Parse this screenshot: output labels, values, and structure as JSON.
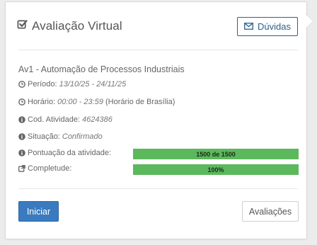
{
  "header": {
    "title": "Avaliação Virtual",
    "icon": "check-square-icon"
  },
  "help_button": {
    "label": "Dúvidas",
    "icon": "envelope-icon"
  },
  "activity": {
    "title": "Av1 - Automação de Processos Industriais",
    "periodo": {
      "label": "Período:",
      "value": "13/10/25 - 24/11/25",
      "icon": "clock-icon"
    },
    "horario": {
      "label": "Horário:",
      "value": "00:00 - 23:59",
      "extra": "(Horário de Brasília)",
      "icon": "clock-icon"
    },
    "codigo": {
      "label": "Cod. Atividade:",
      "value": "4624386",
      "icon": "info-icon"
    },
    "situacao": {
      "label": "Situação:",
      "value": "Confirmado",
      "icon": "info-icon"
    },
    "pontuacao": {
      "label": "Pontuação da atividade:",
      "value": "1500 de 1500",
      "fraction": 1.0,
      "icon": "info-icon"
    },
    "completude": {
      "label": "Completude:",
      "value": "100%",
      "fraction": 1.0,
      "icon": "external-link-icon"
    }
  },
  "actions": {
    "start_label": "Iniciar",
    "evaluations_label": "Avaliações"
  },
  "colors": {
    "primary": "#3a7bc0",
    "progress": "#5cb85c",
    "outline": "#2c5f8a"
  }
}
